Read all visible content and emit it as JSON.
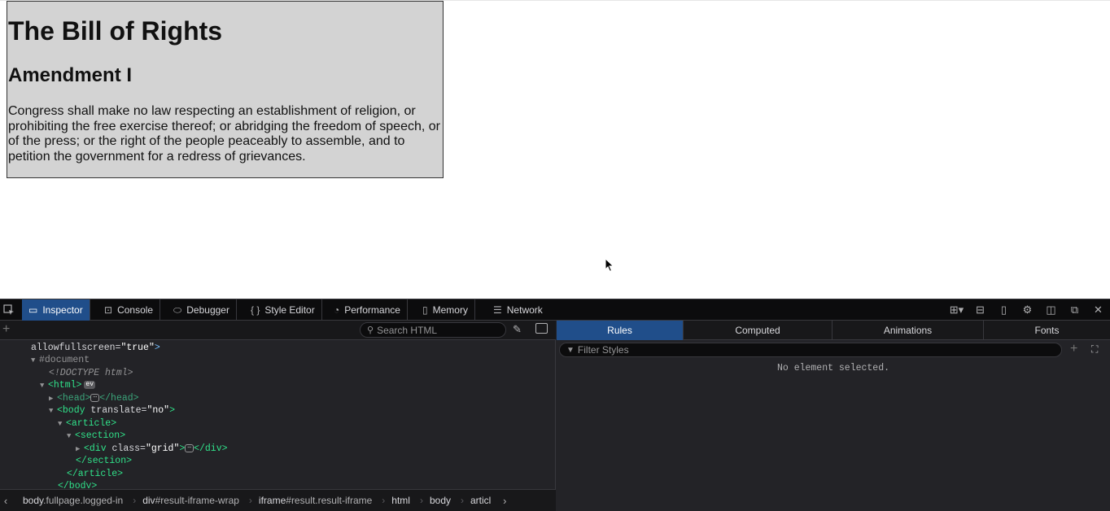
{
  "page": {
    "title": "The Bill of Rights",
    "subtitle": "Amendment I",
    "body": "Congress shall make no law respecting an establishment of religion, or prohibiting the free exercise thereof; or abridging the freedom of speech, or of the press; or the right of the people peaceably to assemble, and to petition the government for a redress of grievances."
  },
  "devtools": {
    "tabs": [
      {
        "label": "Inspector",
        "icon": "inspector-icon"
      },
      {
        "label": "Console",
        "icon": "console-icon"
      },
      {
        "label": "Debugger",
        "icon": "debugger-icon"
      },
      {
        "label": "Style Editor",
        "icon": "style-editor-icon"
      },
      {
        "label": "Performance",
        "icon": "performance-icon"
      },
      {
        "label": "Memory",
        "icon": "memory-icon"
      },
      {
        "label": "Network",
        "icon": "network-icon"
      }
    ],
    "search_placeholder": "Search HTML",
    "tree": {
      "line0_attr": "allowfullscreen",
      "line0_val": "\"true\"",
      "line0_close": ">",
      "document": "#document",
      "doctype": "<!DOCTYPE html>",
      "html_open": "<html>",
      "ev_badge": "ev",
      "head_open": "<head>",
      "head_close": "</head>",
      "ellipsis": "⋯",
      "body_open": "<body",
      "body_attr": "translate",
      "body_val": "\"no\"",
      "article_open": "<article>",
      "section_open": "<section>",
      "div_open": "<div",
      "div_attr": "class",
      "div_val": "\"grid\"",
      "div_close": "</div>",
      "section_close": "</section>",
      "article_close": "</article>",
      "body_close": "</body>"
    },
    "breadcrumbs": [
      {
        "tag": "body",
        "cls": ".fullpage.logged-in"
      },
      {
        "tag": "div",
        "cls": "#result-iframe-wrap"
      },
      {
        "tag": "iframe",
        "cls": "#result.result-iframe"
      },
      {
        "tag": "html",
        "cls": ""
      },
      {
        "tag": "body",
        "cls": ""
      },
      {
        "tag": "articl",
        "cls": ""
      }
    ],
    "side_tabs": [
      "Rules",
      "Computed",
      "Animations",
      "Fonts"
    ],
    "filter_placeholder": "Filter Styles",
    "no_element": "No element selected.",
    "colors": {
      "toolbar_bg": "#0c0c0d",
      "panel_bg": "#232327",
      "active_tab": "#204e8a",
      "tag_blue": "#75bfff",
      "tag_green": "#30e28a"
    }
  }
}
